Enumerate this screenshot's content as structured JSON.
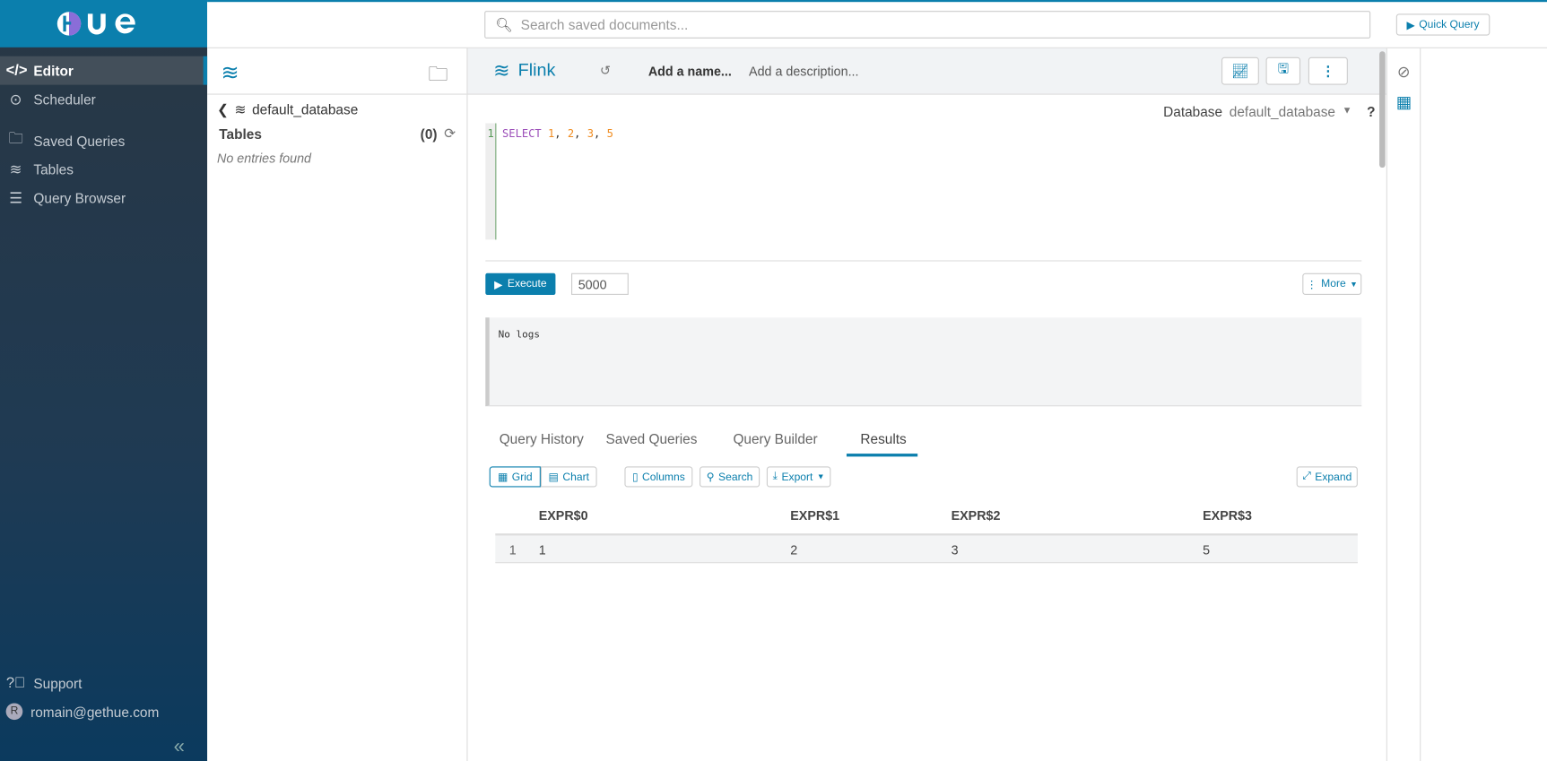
{
  "app": {
    "logo_text": "HUE"
  },
  "sidebar": {
    "items": [
      {
        "label": "Editor",
        "icon": "code-icon"
      },
      {
        "label": "Scheduler",
        "icon": "scheduler-icon"
      },
      {
        "label": "Saved Queries",
        "icon": "folder-icon"
      },
      {
        "label": "Tables",
        "icon": "database-icon"
      },
      {
        "label": "Query Browser",
        "icon": "server-icon"
      }
    ],
    "support": "Support",
    "user": "romain@gethue.com",
    "user_initial": "R"
  },
  "topbar": {
    "search_placeholder": "Search saved documents...",
    "quick_query": "Quick Query"
  },
  "assist": {
    "database": "default_database",
    "tables_label": "Tables",
    "tables_count": "(0)",
    "empty": "No entries found"
  },
  "editor": {
    "engine": "Flink",
    "name_placeholder": "Add a name...",
    "description_placeholder": "Add a description...",
    "database_label": "Database",
    "database_value": "default_database",
    "help": "?",
    "line_number": "1",
    "code": {
      "keyword": "SELECT",
      "values": [
        "1",
        "2",
        "3",
        "5"
      ]
    },
    "execute": "Execute",
    "limit": "5000",
    "more": "More",
    "logs": "No logs"
  },
  "results": {
    "tabs": [
      "Query History",
      "Saved Queries",
      "Query Builder",
      "Results"
    ],
    "active_tab": "Results",
    "toolbar": {
      "grid": "Grid",
      "chart": "Chart",
      "columns": "Columns",
      "search": "Search",
      "export": "Export",
      "expand": "Expand"
    },
    "columns": [
      "EXPR$0",
      "EXPR$1",
      "EXPR$2",
      "EXPR$3"
    ],
    "rows": [
      {
        "index": "1",
        "cells": [
          "1",
          "2",
          "3",
          "5"
        ]
      }
    ]
  },
  "colors": {
    "brand": "#0b7fad",
    "sidebar": "#293744"
  }
}
